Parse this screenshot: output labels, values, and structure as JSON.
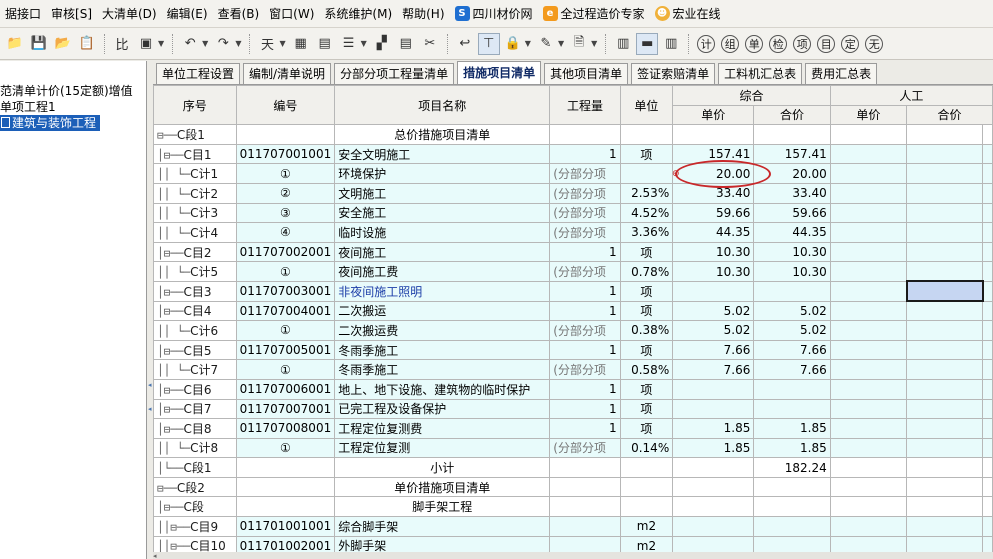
{
  "menu": [
    {
      "label": "据接口",
      "icon": ""
    },
    {
      "label": "审核[S]",
      "icon": ""
    },
    {
      "label": "大清单(D)",
      "icon": ""
    },
    {
      "label": "编辑(E)",
      "icon": ""
    },
    {
      "label": "查看(B)",
      "icon": ""
    },
    {
      "label": "窗口(W)",
      "icon": ""
    },
    {
      "label": "系统维护(M)",
      "icon": ""
    },
    {
      "label": "帮助(H)",
      "icon": ""
    },
    {
      "label": "四川材价网",
      "icon": "S"
    },
    {
      "label": "全过程造价专家",
      "icon": "e"
    },
    {
      "label": "宏业在线",
      "icon": "☻"
    }
  ],
  "toolbar": {
    "buttons1": [
      "📁",
      "💾",
      "📂",
      "📋"
    ],
    "buttons2": [
      "比",
      "▣"
    ],
    "buttons3": [
      "↶",
      "↷"
    ],
    "buttons4": [
      "天",
      "▦",
      "▤",
      "☰",
      "▞",
      "▤",
      "✂"
    ],
    "buttons5": [
      "↩",
      "⊤",
      "🔒",
      "✎",
      "🗎"
    ],
    "buttons6": [
      "▥",
      "▬",
      "▥"
    ],
    "circles": [
      "计",
      "组",
      "单",
      "检",
      "项",
      "目",
      "定",
      "无"
    ]
  },
  "tree": {
    "line1": "范清单计价(15定额)增值",
    "line2": "单项工程1",
    "selected": "建筑与装饰工程"
  },
  "tabs": [
    "单位工程设置",
    "编制/清单说明",
    "分部分项工程量清单",
    "措施项目清单",
    "其他项目清单",
    "签证索赔清单",
    "工料机汇总表",
    "费用汇总表"
  ],
  "header": {
    "seq": "序号",
    "code": "编号",
    "name": "项目名称",
    "qty": "工程量",
    "unit": "单位",
    "zonghe": "综合",
    "zonghe_unit_price": "单价",
    "zonghe_total": "合价",
    "rengong": "人工",
    "rengong_unit_price": "单价",
    "rengong_total": "合价"
  },
  "rows": [
    {
      "tree": "⊟──",
      "seq": "C段1",
      "code": "",
      "name": "总价措施项目清单",
      "qty": "",
      "unit": "",
      "price": "",
      "total": "",
      "style": "section"
    },
    {
      "tree": "│⊟──",
      "seq": "C目1",
      "code": "011707001001",
      "name": "安全文明施工",
      "qty": "1",
      "unit": "项",
      "price": "157.41",
      "total": "157.41",
      "style": "cyan"
    },
    {
      "tree": "││ └─",
      "seq": "C计1",
      "code": "①",
      "name": "环境保护",
      "qty": "(分部分项",
      "unit": "",
      "price": "20.00",
      "total": "20.00",
      "style": "cyan"
    },
    {
      "tree": "││ └─",
      "seq": "C计2",
      "code": "②",
      "name": "文明施工",
      "qty": "(分部分项",
      "unit": "2.53%",
      "price": "33.40",
      "total": "33.40",
      "style": "cyan"
    },
    {
      "tree": "││ └─",
      "seq": "C计3",
      "code": "③",
      "name": "安全施工",
      "qty": "(分部分项",
      "unit": "4.52%",
      "price": "59.66",
      "total": "59.66",
      "style": "cyan"
    },
    {
      "tree": "││ └─",
      "seq": "C计4",
      "code": "④",
      "name": "临时设施",
      "qty": "(分部分项",
      "unit": "3.36%",
      "price": "44.35",
      "total": "44.35",
      "style": "cyan"
    },
    {
      "tree": "│⊟──",
      "seq": "C目2",
      "code": "011707002001",
      "name": "夜间施工",
      "qty": "1",
      "unit": "项",
      "price": "10.30",
      "total": "10.30",
      "style": "cyan"
    },
    {
      "tree": "││ └─",
      "seq": "C计5",
      "code": "①",
      "name": "夜间施工费",
      "qty": "(分部分项",
      "unit": "0.78%",
      "price": "10.30",
      "total": "10.30",
      "style": "cyan"
    },
    {
      "tree": "│⊟──",
      "seq": "C目3",
      "code": "011707003001",
      "name": "非夜间施工照明",
      "qty": "1",
      "unit": "项",
      "price": "",
      "total": "",
      "style": "cyan-blue"
    },
    {
      "tree": "│⊟──",
      "seq": "C目4",
      "code": "011707004001",
      "name": "二次搬运",
      "qty": "1",
      "unit": "项",
      "price": "5.02",
      "total": "5.02",
      "style": "cyan"
    },
    {
      "tree": "││ └─",
      "seq": "C计6",
      "code": "①",
      "name": "二次搬运费",
      "qty": "(分部分项",
      "unit": "0.38%",
      "price": "5.02",
      "total": "5.02",
      "style": "cyan"
    },
    {
      "tree": "│⊟──",
      "seq": "C目5",
      "code": "011707005001",
      "name": "冬雨季施工",
      "qty": "1",
      "unit": "项",
      "price": "7.66",
      "total": "7.66",
      "style": "cyan"
    },
    {
      "tree": "││ └─",
      "seq": "C计7",
      "code": "①",
      "name": "冬雨季施工",
      "qty": "(分部分项",
      "unit": "0.58%",
      "price": "7.66",
      "total": "7.66",
      "style": "cyan"
    },
    {
      "tree": "│⊟──",
      "seq": "C目6",
      "code": "011707006001",
      "name": "地上、地下设施、建筑物的临时保护",
      "qty": "1",
      "unit": "项",
      "price": "",
      "total": "",
      "style": "cyan"
    },
    {
      "tree": "│⊟──",
      "seq": "C目7",
      "code": "011707007001",
      "name": "已完工程及设备保护",
      "qty": "1",
      "unit": "项",
      "price": "",
      "total": "",
      "style": "cyan"
    },
    {
      "tree": "│⊟──",
      "seq": "C目8",
      "code": "011707008001",
      "name": "工程定位复测费",
      "qty": "1",
      "unit": "项",
      "price": "1.85",
      "total": "1.85",
      "style": "cyan"
    },
    {
      "tree": "││ └─",
      "seq": "C计8",
      "code": "①",
      "name": "工程定位复测",
      "qty": "(分部分项",
      "unit": "0.14%",
      "price": "1.85",
      "total": "1.85",
      "style": "cyan"
    },
    {
      "tree": "│└──",
      "seq": "C段1",
      "code": "",
      "name": "小计",
      "qty": "",
      "unit": "",
      "price": "",
      "total": "182.24",
      "style": "section"
    },
    {
      "tree": "⊟──",
      "seq": "C段2",
      "code": "",
      "name": "单价措施项目清单",
      "qty": "",
      "unit": "",
      "price": "",
      "total": "",
      "style": "section"
    },
    {
      "tree": "│⊟──",
      "seq": "C段",
      "code": "",
      "name": "脚手架工程",
      "qty": "",
      "unit": "",
      "price": "",
      "total": "",
      "style": "section"
    },
    {
      "tree": "││⊟──",
      "seq": "C目9",
      "code": "011701001001",
      "name": "综合脚手架",
      "qty": "",
      "unit": "m2",
      "price": "",
      "total": "",
      "style": "cyan"
    },
    {
      "tree": "││⊟──",
      "seq": "C目10",
      "code": "011701002001",
      "name": "外脚手架",
      "qty": "",
      "unit": "m2",
      "price": "",
      "total": "",
      "style": "cyan"
    }
  ]
}
